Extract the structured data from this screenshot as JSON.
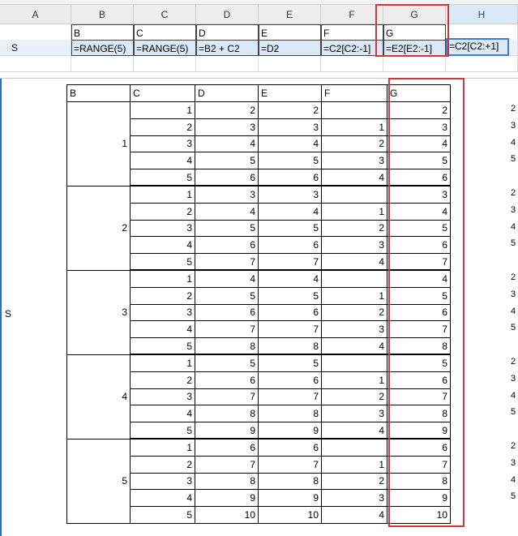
{
  "columns": [
    "A",
    "B",
    "C",
    "D",
    "E",
    "F",
    "G",
    "H"
  ],
  "row1": {
    "B": "B",
    "C": "C",
    "D": "D",
    "E": "E",
    "F": "F",
    "G": "G"
  },
  "row2": {
    "A": "S",
    "B": "=RANGE(5)",
    "C": "=RANGE(5)",
    "D": "=B2 + C2",
    "E": "=D2",
    "F": "=C2[C2:-1]",
    "G": "=E2[E2:-1]",
    "H": "=C2[C2:+1]"
  },
  "result": {
    "side_label": "S",
    "headers": [
      "B",
      "C",
      "D",
      "E",
      "F",
      "G"
    ],
    "groups": [
      {
        "b": "1",
        "rows": [
          [
            "1",
            "2",
            "2",
            "",
            "2"
          ],
          [
            "2",
            "3",
            "3",
            "1",
            "3"
          ],
          [
            "3",
            "4",
            "4",
            "2",
            "4"
          ],
          [
            "4",
            "5",
            "5",
            "3",
            "5"
          ],
          [
            "5",
            "6",
            "6",
            "4",
            "6"
          ]
        ]
      },
      {
        "b": "2",
        "rows": [
          [
            "1",
            "3",
            "3",
            "",
            "3"
          ],
          [
            "2",
            "4",
            "4",
            "1",
            "4"
          ],
          [
            "3",
            "5",
            "5",
            "2",
            "5"
          ],
          [
            "4",
            "6",
            "6",
            "3",
            "6"
          ],
          [
            "5",
            "7",
            "7",
            "4",
            "7"
          ]
        ]
      },
      {
        "b": "3",
        "rows": [
          [
            "1",
            "4",
            "4",
            "",
            "4"
          ],
          [
            "2",
            "5",
            "5",
            "1",
            "5"
          ],
          [
            "3",
            "6",
            "6",
            "2",
            "6"
          ],
          [
            "4",
            "7",
            "7",
            "3",
            "7"
          ],
          [
            "5",
            "8",
            "8",
            "4",
            "8"
          ]
        ]
      },
      {
        "b": "4",
        "rows": [
          [
            "1",
            "5",
            "5",
            "",
            "5"
          ],
          [
            "2",
            "6",
            "6",
            "1",
            "6"
          ],
          [
            "3",
            "7",
            "7",
            "2",
            "7"
          ],
          [
            "4",
            "8",
            "8",
            "3",
            "8"
          ],
          [
            "5",
            "9",
            "9",
            "4",
            "9"
          ]
        ]
      },
      {
        "b": "5",
        "rows": [
          [
            "1",
            "6",
            "6",
            "",
            "6"
          ],
          [
            "2",
            "7",
            "7",
            "1",
            "7"
          ],
          [
            "3",
            "8",
            "8",
            "2",
            "8"
          ],
          [
            "4",
            "9",
            "9",
            "3",
            "9"
          ],
          [
            "5",
            "10",
            "10",
            "4",
            "10"
          ]
        ]
      }
    ],
    "h_column_partial": [
      "2",
      "3",
      "4",
      "5"
    ]
  },
  "colors": {
    "highlight_box": "#d9343a",
    "selection": "#3b7ddd",
    "row_highlight": "#dce8f6"
  }
}
